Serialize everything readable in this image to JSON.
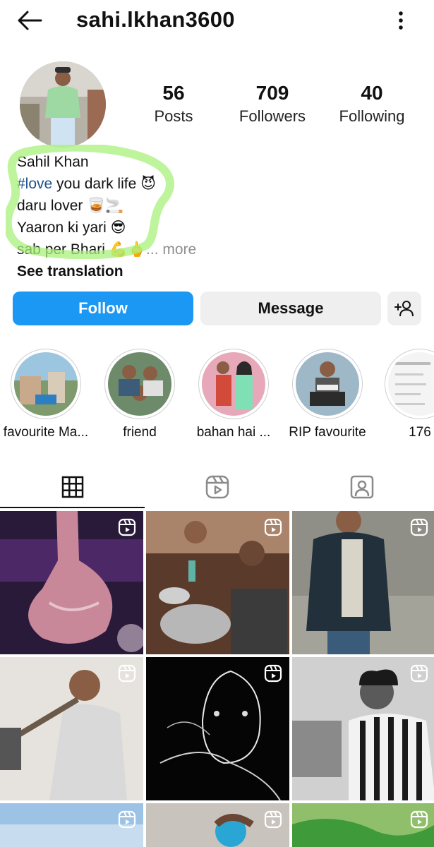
{
  "header": {
    "username": "sahi.lkhan3600",
    "back_icon": "arrow-left-icon",
    "menu_icon": "more-vertical-icon"
  },
  "stats": {
    "posts_count": "56",
    "posts_label": "Posts",
    "followers_count": "709",
    "followers_label": "Followers",
    "following_count": "40",
    "following_label": "Following"
  },
  "bio": {
    "name": "Sahil Khan",
    "hashtag": "#love",
    "line1_rest": " you dark life 😈",
    "line2": "daru lover 🥃🚬",
    "line3": "Yaaron ki yari 😎",
    "line4": " sab per Bhari 💪🖕",
    "more": "... more",
    "see_translation": "See translation"
  },
  "actions": {
    "follow_label": "Follow",
    "message_label": "Message",
    "add_user_icon": "add-user-icon"
  },
  "highlights": [
    {
      "label": "favourite Ma..."
    },
    {
      "label": "friend"
    },
    {
      "label": "bahan hai ..."
    },
    {
      "label": "RIP favourite"
    },
    {
      "label": "176"
    }
  ],
  "tabs": [
    {
      "icon": "grid-icon",
      "active": true
    },
    {
      "icon": "reels-icon",
      "active": false
    },
    {
      "icon": "tagged-icon",
      "active": false
    }
  ],
  "colors": {
    "follow_button": "#1a98f4",
    "secondary_button": "#efefef",
    "hashtag": "#1d4f8c",
    "annotation_marker": "#a8f07a"
  }
}
